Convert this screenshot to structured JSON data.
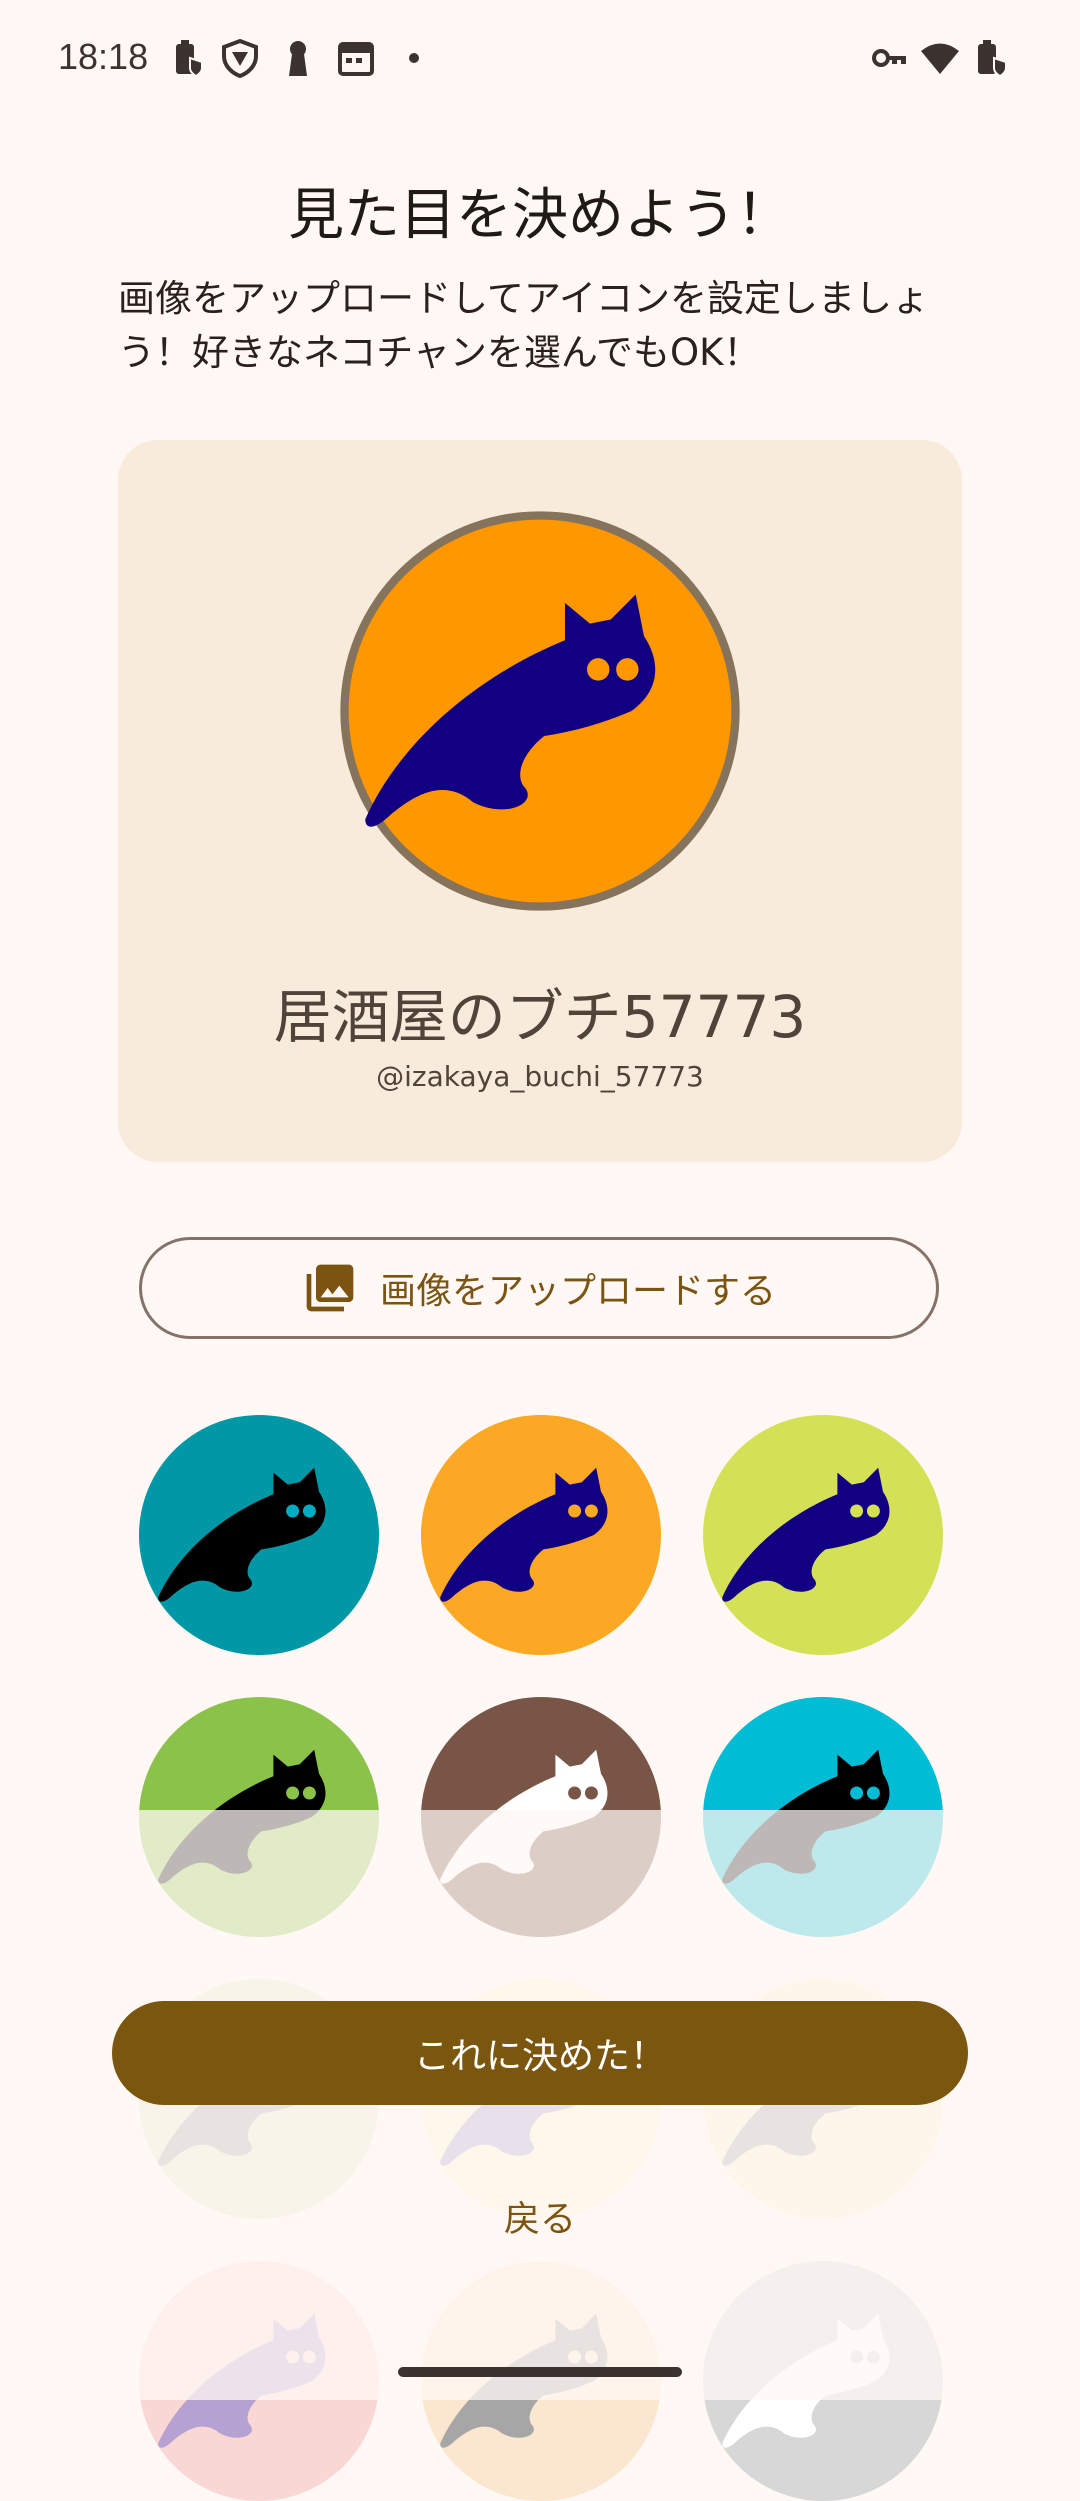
{
  "status_bar": {
    "time": "18:18",
    "left_icons": [
      "battery-saver-icon",
      "vpn-shield-icon",
      "keyhole-icon",
      "calendar-icon",
      "notification-dot-icon"
    ],
    "right_icons": [
      "vpn-key-icon",
      "wifi-icon",
      "battery-charging-icon"
    ]
  },
  "header": {
    "title": "見た目を決めよう！",
    "description": "画像をアップロードしてアイコンを設定しましょう！好きなネコチャンを選んでもOK！"
  },
  "profile_card": {
    "display_name": "居酒屋のブチ57773",
    "handle": "@izakaya_buchi_57773",
    "avatar": {
      "bg": "#FF9800",
      "cat": "#120083",
      "eyes": "#FF9800",
      "ring": "#85735C"
    }
  },
  "upload_button": {
    "label": "画像をアップロードする",
    "icon": "photo-library-icon"
  },
  "avatar_options": [
    {
      "bg": "#0097A7",
      "cat": "#000000",
      "eyes": "#00ACC1"
    },
    {
      "bg": "#FBA825",
      "cat": "#120083",
      "eyes": "#FBA825"
    },
    {
      "bg": "#D4E157",
      "cat": "#120083",
      "eyes": "#D4E157"
    },
    {
      "bg": "#8BC34A",
      "cat": "#000000",
      "eyes": "#8BC34A"
    },
    {
      "bg": "#795548",
      "cat": "#FFFFFF",
      "eyes": "#795548"
    },
    {
      "bg": "#00BCD4",
      "cat": "#000000",
      "eyes": "#00BCD4"
    },
    {
      "bg": "#E3E9CC",
      "cat": "#A6A6A6",
      "eyes": "#E3E9CC"
    },
    {
      "bg": "#FBF2D2",
      "cat": "#A59FD0",
      "eyes": "#FBF2D2"
    },
    {
      "bg": "#F6F1D0",
      "cat": "#A6A6A6",
      "eyes": "#F6F1D0"
    },
    {
      "bg": "#F9D7D4",
      "cat": "#B5A2D2",
      "eyes": "#F9D7D4"
    },
    {
      "bg": "#FBE6CF",
      "cat": "#A6A6A6",
      "eyes": "#FBE6CF"
    },
    {
      "bg": "#D7D7D7",
      "cat": "#FFFFFF",
      "eyes": "#D7D7D7"
    }
  ],
  "actions": {
    "decide_label": "これに決めた！",
    "back_label": "戻る"
  }
}
